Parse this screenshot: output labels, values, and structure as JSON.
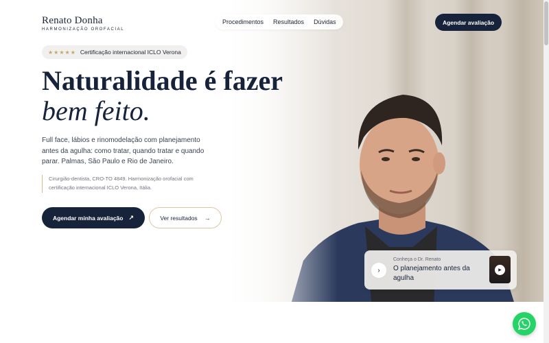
{
  "header": {
    "logo_name": "Renato Donha",
    "logo_subtitle": "HARMONIZAÇÃO OROFACIAL",
    "nav": [
      "Procedimentos",
      "Resultados",
      "Dúvidas"
    ],
    "cta": "Agendar avaliação"
  },
  "hero": {
    "badge_stars": "★★★★★",
    "badge_text": "Certificação internacional ICLO Verona",
    "headline_line1": "Naturalidade é fazer",
    "headline_line2": "bem feito.",
    "lead": "Full face, lábios e rinomodelação com planejamento antes da agulha: como tratar, quando tratar e quando parar. Palmas, São Paulo e Rio de Janeiro.",
    "note": "Cirurgião-dentista, CRO-TO 4849. Harmonização orofacial com certificação internacional ICLO Verona, Itália.",
    "primary_button": "Agendar minha avaliação",
    "secondary_button": "Ver resultados"
  },
  "video_card": {
    "kicker": "Conheça o Dr. Renato",
    "title": "O planejamento antes da agulha"
  },
  "icons": {
    "primary_button_icon": "arrow-up-right-icon",
    "secondary_button_icon": "arrow-right-icon",
    "video_card_icon": "chevron-right-icon",
    "thumb_icon": "play-icon",
    "floating_icon": "whatsapp-icon"
  },
  "colors": {
    "navy": "#16233a",
    "gold": "#c6a46a",
    "whatsapp": "#25d366"
  }
}
